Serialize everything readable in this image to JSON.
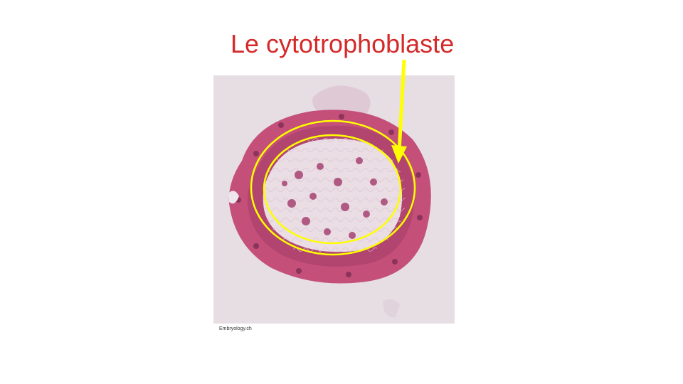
{
  "slide": {
    "title": "Le cytotrophoblaste",
    "credit": "Embryology.ch",
    "micrograph": {
      "subject": "blastocyst-section",
      "stain": "hematoxylin-eosin"
    },
    "annotation": {
      "arrow_icon": "arrow-down-icon",
      "ring_icon": "ellipse-ring-icon"
    },
    "colors": {
      "title": "#d42a2a",
      "annotation": "#ffff00",
      "tissue": "#c7517a",
      "background": "#e6dde3"
    }
  }
}
